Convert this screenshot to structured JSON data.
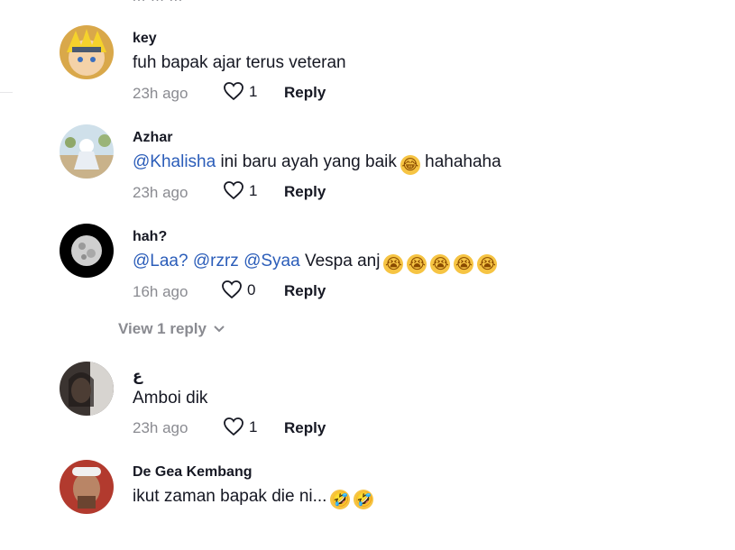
{
  "cut_text": "… … …",
  "comments": [
    {
      "user": "key",
      "text_parts": [
        {
          "t": "fuh bapak ajar terus veteran",
          "m": false
        }
      ],
      "time": "23h ago",
      "likes": "1",
      "reply": "Reply",
      "emojis": []
    },
    {
      "user": "Azhar",
      "text_parts": [
        {
          "t": "@Khalisha",
          "m": true
        },
        {
          "t": " ini baru ayah yang baik",
          "m": false
        }
      ],
      "after_emoji": " hahahaha",
      "time": "23h ago",
      "likes": "1",
      "reply": "Reply",
      "emojis": [
        "😂"
      ]
    },
    {
      "user": "hah?",
      "text_parts": [
        {
          "t": "@Laa?",
          "m": true
        },
        {
          "t": " ",
          "m": false
        },
        {
          "t": "@rzrz",
          "m": true
        },
        {
          "t": " ",
          "m": false
        },
        {
          "t": "@Syaa",
          "m": true
        },
        {
          "t": " Vespa anj",
          "m": false
        }
      ],
      "time": "16h ago",
      "likes": "0",
      "reply": "Reply",
      "emojis": [
        "😭",
        "😭",
        "😭",
        "😭",
        "😭"
      ]
    },
    {
      "user": "ع",
      "text_parts": [
        {
          "t": "Amboi dik",
          "m": false
        }
      ],
      "time": "23h ago",
      "likes": "1",
      "reply": "Reply",
      "emojis": []
    },
    {
      "user": "De Gea Kembang",
      "text_parts": [
        {
          "t": "ikut zaman bapak die ni...",
          "m": false
        }
      ],
      "time": "",
      "likes": "",
      "reply": "",
      "emojis": [
        "🤣",
        "🤣"
      ]
    }
  ],
  "view_reply": "View 1 reply",
  "icons": {
    "like": "heart-icon",
    "expand": "chevron-down-icon"
  }
}
